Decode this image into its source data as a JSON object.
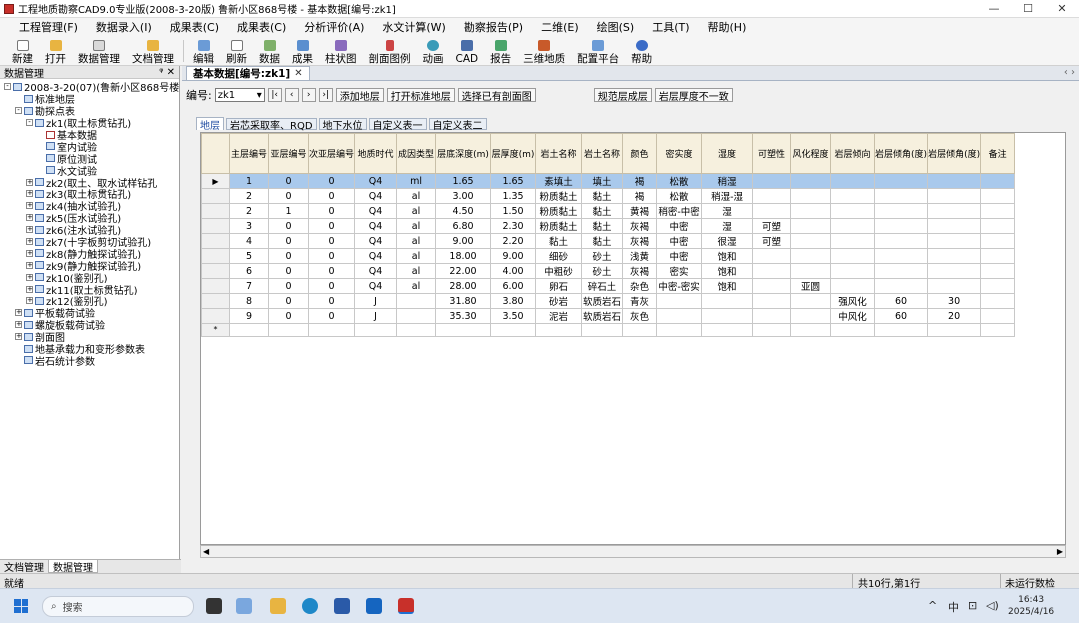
{
  "window": {
    "title": "工程地质勘察CAD9.0专业版(2008-3-20版) 鲁新小区868号楼 - 基本数据[编号:zk1]",
    "min": "—",
    "max": "☐",
    "close": "✕"
  },
  "menu": [
    "工程管理(F)",
    "数据录入(I)",
    "成果表(C)",
    "成果表(C)",
    "分析评价(A)",
    "水文计算(W)",
    "勘察报告(P)",
    "二维(E)",
    "绘图(S)",
    "工具(T)",
    "帮助(H)"
  ],
  "toolbar": [
    "新建",
    "打开",
    "数据管理",
    "文档管理",
    "编辑",
    "刷新",
    "数据",
    "成果",
    "柱状图",
    "剖面图例",
    "动画",
    "CAD",
    "报告",
    "三维地质",
    "配置平台",
    "帮助"
  ],
  "left_panel": {
    "title": "数据管理",
    "pin": "ᵠ ✕",
    "tree": [
      {
        "t": "2008-3-20(07)(鲁新小区868号楼",
        "lvl": 0,
        "tw": "-",
        "kind": "root"
      },
      {
        "t": "标准地层",
        "lvl": 1,
        "tw": "",
        "kind": "node"
      },
      {
        "t": "勘探点表",
        "lvl": 1,
        "tw": "-",
        "kind": "node"
      },
      {
        "t": "zk1(取土标贯钻孔)",
        "lvl": 2,
        "tw": "-",
        "kind": "node"
      },
      {
        "t": "基本数据",
        "lvl": 3,
        "tw": "",
        "kind": "chk"
      },
      {
        "t": "室内试验",
        "lvl": 3,
        "tw": "",
        "kind": "node"
      },
      {
        "t": "原位测试",
        "lvl": 3,
        "tw": "",
        "kind": "node"
      },
      {
        "t": "水文试验",
        "lvl": 3,
        "tw": "",
        "kind": "node"
      },
      {
        "t": "zk2(取土、取水试样钻孔",
        "lvl": 2,
        "tw": "+",
        "kind": "node"
      },
      {
        "t": "zk3(取土标贯钻孔)",
        "lvl": 2,
        "tw": "+",
        "kind": "node"
      },
      {
        "t": "zk4(抽水试验孔)",
        "lvl": 2,
        "tw": "+",
        "kind": "node"
      },
      {
        "t": "zk5(压水试验孔)",
        "lvl": 2,
        "tw": "+",
        "kind": "node"
      },
      {
        "t": "zk6(注水试验孔)",
        "lvl": 2,
        "tw": "+",
        "kind": "node"
      },
      {
        "t": "zk7(十字板剪切试验孔)",
        "lvl": 2,
        "tw": "+",
        "kind": "node"
      },
      {
        "t": "zk8(静力触探试验孔)",
        "lvl": 2,
        "tw": "+",
        "kind": "node"
      },
      {
        "t": "zk9(静力触探试验孔)",
        "lvl": 2,
        "tw": "+",
        "kind": "node"
      },
      {
        "t": "zk10(鉴别孔)",
        "lvl": 2,
        "tw": "+",
        "kind": "node"
      },
      {
        "t": "zk11(取土标贯钻孔)",
        "lvl": 2,
        "tw": "+",
        "kind": "node"
      },
      {
        "t": "zk12(鉴别孔)",
        "lvl": 2,
        "tw": "+",
        "kind": "node"
      },
      {
        "t": "平板载荷试验",
        "lvl": 1,
        "tw": "+",
        "kind": "node"
      },
      {
        "t": "螺旋板载荷试验",
        "lvl": 1,
        "tw": "+",
        "kind": "node"
      },
      {
        "t": "剖面图",
        "lvl": 1,
        "tw": "+",
        "kind": "node"
      },
      {
        "t": "地基承载力和变形参数表",
        "lvl": 1,
        "tw": "",
        "kind": "node"
      },
      {
        "t": "岩石统计参数",
        "lvl": 1,
        "tw": "",
        "kind": "node"
      }
    ],
    "tabs": [
      "文档管理",
      "数据管理"
    ]
  },
  "doc": {
    "tab": "基本数据[编号:zk1]",
    "close": "✕",
    "arrows": "‹ ›",
    "toolbar": {
      "label": "编号:",
      "value": "zk1",
      "nav": [
        "|‹",
        "‹",
        "›",
        "›|"
      ],
      "buttons": [
        "添加地层",
        "打开标准地层",
        "选择已有剖面图",
        "",
        "规范层成层",
        "岩层厚度不一致"
      ]
    },
    "subtabs": [
      "地层",
      "岩芯采取率、RQD",
      "地下水位",
      "自定义表一",
      "自定义表二"
    ],
    "columns": [
      "主层编号",
      "亚层编号",
      "次亚层编号",
      "地质时代",
      "成因类型",
      "层底深度(m)",
      "层厚度(m)",
      "岩土名称",
      "岩土名称",
      "颜色",
      "密实度",
      "湿度",
      "可塑性",
      "风化程度",
      "岩层倾向",
      "岩层倾角(度)",
      "岩层倾角(度)",
      "备注"
    ],
    "rows": [
      [
        "1",
        "0",
        "0",
        "Q4",
        "ml",
        "1.65",
        "1.65",
        "素填土",
        "填土",
        "褐",
        "松散",
        "稍湿",
        "",
        "",
        "",
        "",
        "",
        ""
      ],
      [
        "2",
        "0",
        "0",
        "Q4",
        "al",
        "3.00",
        "1.35",
        "粉质黏土",
        "黏土",
        "褐",
        "松散",
        "稍湿-湿",
        "",
        "",
        "",
        "",
        "",
        ""
      ],
      [
        "2",
        "1",
        "0",
        "Q4",
        "al",
        "4.50",
        "1.50",
        "粉质黏土",
        "黏土",
        "黄褐",
        "稍密-中密",
        "湿",
        "",
        "",
        "",
        "",
        "",
        ""
      ],
      [
        "3",
        "0",
        "0",
        "Q4",
        "al",
        "6.80",
        "2.30",
        "粉质黏土",
        "黏土",
        "灰褐",
        "中密",
        "湿",
        "可塑",
        "",
        "",
        "",
        "",
        ""
      ],
      [
        "4",
        "0",
        "0",
        "Q4",
        "al",
        "9.00",
        "2.20",
        "黏土",
        "黏土",
        "灰褐",
        "中密",
        "很湿",
        "可塑",
        "",
        "",
        "",
        "",
        ""
      ],
      [
        "5",
        "0",
        "0",
        "Q4",
        "al",
        "18.00",
        "9.00",
        "细砂",
        "砂土",
        "浅黄",
        "中密",
        "饱和",
        "",
        "",
        "",
        "",
        "",
        ""
      ],
      [
        "6",
        "0",
        "0",
        "Q4",
        "al",
        "22.00",
        "4.00",
        "中粗砂",
        "砂土",
        "灰褐",
        "密实",
        "饱和",
        "",
        "",
        "",
        "",
        "",
        ""
      ],
      [
        "7",
        "0",
        "0",
        "Q4",
        "al",
        "28.00",
        "6.00",
        "卵石",
        "碎石土",
        "杂色",
        "中密-密实",
        "饱和",
        "",
        "亚圆",
        "",
        "",
        "",
        ""
      ],
      [
        "8",
        "0",
        "0",
        "J",
        "",
        "31.80",
        "3.80",
        "砂岩",
        "软质岩石",
        "青灰",
        "",
        "",
        "",
        "",
        "强风化",
        "60",
        "30",
        ""
      ],
      [
        "9",
        "0",
        "0",
        "J",
        "",
        "35.30",
        "3.50",
        "泥岩",
        "软质岩石",
        "灰色",
        "",
        "",
        "",
        "",
        "中风化",
        "60",
        "20",
        ""
      ]
    ],
    "new_row_marker": "*",
    "current_marker": "▶"
  },
  "statusbar": {
    "left": "就绪",
    "mid": "共10行,第1行",
    "right": "未运行数检"
  },
  "taskbar": {
    "search": "搜索",
    "tray": [
      "^",
      "中",
      "⊡",
      "◁)"
    ],
    "time": "16:43",
    "date": "2025/4/16"
  }
}
